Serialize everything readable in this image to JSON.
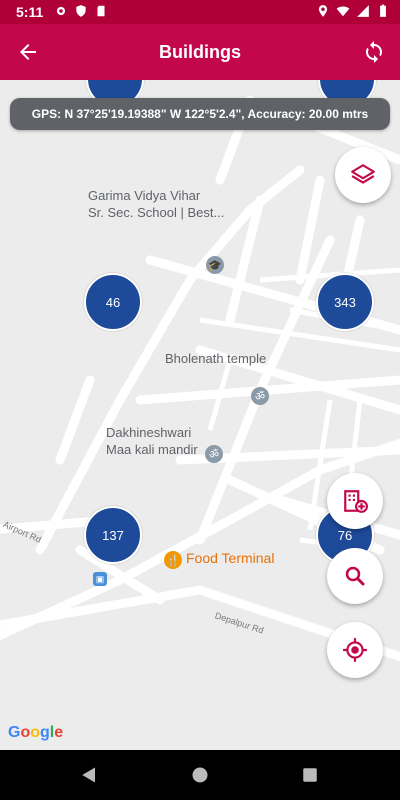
{
  "status_bar": {
    "time": "5:11"
  },
  "app_bar": {
    "title": "Buildings"
  },
  "gps_banner": {
    "text": "GPS: N 37°25'19.19388\" W 122°5'2.4\", Accuracy: 20.00 mtrs"
  },
  "map": {
    "places": [
      {
        "name_line1": "Garima Vidya Vihar",
        "name_line2": "Sr. Sec. School | Best..."
      },
      {
        "name_line1": "Bholenath temple"
      },
      {
        "name_line1": "Dakhineshwari",
        "name_line2": "Maa kali mandir"
      },
      {
        "name_line1": "Food Terminal"
      }
    ],
    "roads": {
      "airport": "Airport Rd",
      "depalpur": "Depalpur Rd"
    },
    "clusters": [
      "46",
      "343",
      "137",
      "76"
    ],
    "attribution": "Google"
  },
  "colors": {
    "primary": "#c2084a",
    "cluster": "#1e4a9a",
    "accent": "#c2084a"
  },
  "icons": [
    "back-arrow-icon",
    "sync-icon",
    "layers-icon",
    "add-building-icon",
    "search-icon",
    "my-location-icon"
  ]
}
